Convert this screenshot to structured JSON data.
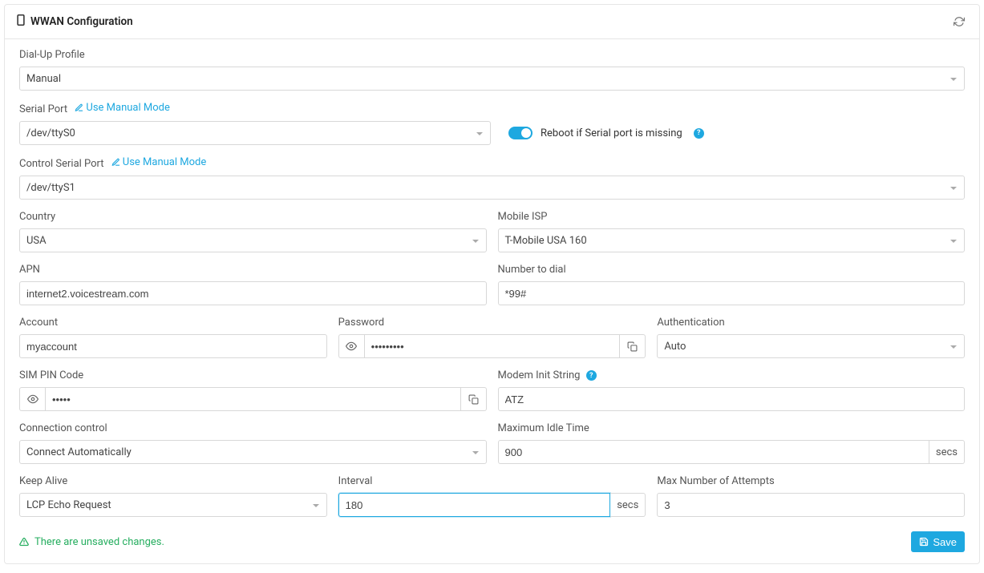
{
  "panel": {
    "title": "WWAN Configuration"
  },
  "dialup": {
    "label": "Dial-Up Profile",
    "value": "Manual"
  },
  "serial": {
    "label": "Serial Port",
    "manual_link": "Use Manual Mode",
    "value": "/dev/ttyS0",
    "reboot_label": "Reboot if Serial port is missing"
  },
  "control_serial": {
    "label": "Control Serial Port",
    "manual_link": "Use Manual Mode",
    "value": "/dev/ttyS1"
  },
  "country": {
    "label": "Country",
    "value": "USA"
  },
  "isp": {
    "label": "Mobile ISP",
    "value": "T-Mobile USA 160"
  },
  "apn": {
    "label": "APN",
    "value": "internet2.voicestream.com"
  },
  "dial": {
    "label": "Number to dial",
    "value": "*99#"
  },
  "account": {
    "label": "Account",
    "value": "myaccount"
  },
  "password": {
    "label": "Password",
    "value": "•••••••••"
  },
  "auth": {
    "label": "Authentication",
    "value": "Auto"
  },
  "pin": {
    "label": "SIM PIN Code",
    "value": "•••••"
  },
  "modem": {
    "label": "Modem Init String",
    "value": "ATZ"
  },
  "connection": {
    "label": "Connection control",
    "value": "Connect Automatically"
  },
  "idle": {
    "label": "Maximum Idle Time",
    "value": "900",
    "unit": "secs"
  },
  "keepalive": {
    "label": "Keep Alive",
    "value": "LCP Echo Request"
  },
  "interval": {
    "label": "Interval",
    "value": "180",
    "unit": "secs"
  },
  "attempts": {
    "label": "Max Number of Attempts",
    "value": "3"
  },
  "footer": {
    "unsaved": "There are unsaved changes.",
    "save": "Save"
  }
}
